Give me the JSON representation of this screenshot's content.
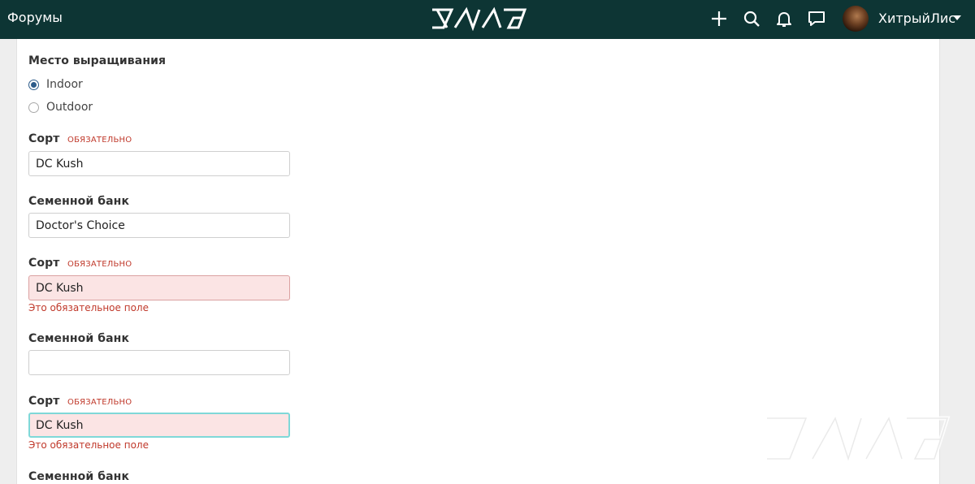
{
  "topbar": {
    "forums_label": "Форумы",
    "logo_name": "site-logo",
    "icons": [
      "plus-icon",
      "search-icon",
      "bell-icon",
      "chat-icon"
    ],
    "username": "ХитрыйЛис",
    "bg_color": "#0d3534"
  },
  "form": {
    "grow_place_label": "Место выращивания",
    "grow_options": [
      {
        "label": "Indoor",
        "checked": true
      },
      {
        "label": "Outdoor",
        "checked": false
      }
    ],
    "required_text": "ОБЯЗАТЕЛЬНО",
    "strain_label": "Сорт",
    "seedbank_label": "Семенной банк",
    "strain1_value": "DC Kush",
    "seedbank1_value": "Doctor's Choice",
    "strain2_value": "DC Kush",
    "strain2_error": "Это обязательное поле",
    "seedbank2_value": "",
    "strain3_value": "DC Kush",
    "strain3_error": "Это обязательное поле",
    "seedbank3_label": "Семенной банк"
  },
  "colors": {
    "error_text": "#c0392b",
    "error_bg": "#fbe4e4",
    "focus_border": "#7fd8d8"
  }
}
